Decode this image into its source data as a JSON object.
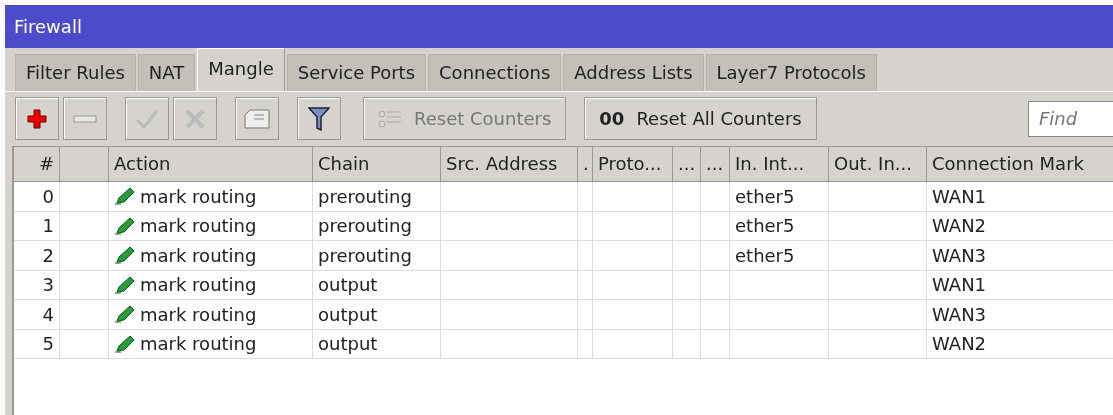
{
  "window": {
    "title": "Firewall"
  },
  "tabs": [
    {
      "label": "Filter Rules",
      "selected": false
    },
    {
      "label": "NAT",
      "selected": false
    },
    {
      "label": "Mangle",
      "selected": true
    },
    {
      "label": "Service Ports",
      "selected": false
    },
    {
      "label": "Connections",
      "selected": false
    },
    {
      "label": "Address Lists",
      "selected": false
    },
    {
      "label": "Layer7 Protocols",
      "selected": false
    }
  ],
  "toolbar": [
    {
      "kind": "add",
      "disabled": false
    },
    {
      "kind": "remove",
      "disabled": false
    },
    {
      "kind": "enable",
      "disabled": true
    },
    {
      "kind": "disable",
      "disabled": true
    },
    {
      "kind": "comment",
      "disabled": false
    },
    {
      "kind": "filter",
      "disabled": false
    },
    {
      "kind": "reset",
      "label": "Reset Counters",
      "disabled": true
    },
    {
      "kind": "reset_all",
      "mark": "00",
      "label": "Reset All Counters",
      "disabled": false
    }
  ],
  "search": {
    "placeholder": "Find"
  },
  "table": {
    "columns": [
      "#",
      "",
      "Action",
      "Chain",
      "Src. Address",
      ".",
      "Proto...",
      "...",
      "...",
      "In. Int...",
      "Out. In...",
      "Connection Mark"
    ],
    "rows": [
      {
        "number": "0",
        "action": "mark routing",
        "chain": "prerouting",
        "in_interface": "ether5",
        "connection_mark": "WAN1"
      },
      {
        "number": "1",
        "action": "mark routing",
        "chain": "prerouting",
        "in_interface": "ether5",
        "connection_mark": "WAN2"
      },
      {
        "number": "2",
        "action": "mark routing",
        "chain": "prerouting",
        "in_interface": "ether5",
        "connection_mark": "WAN3"
      },
      {
        "number": "3",
        "action": "mark routing",
        "chain": "output",
        "connection_mark": "WAN1"
      },
      {
        "number": "4",
        "action": "mark routing",
        "chain": "output",
        "connection_mark": "WAN3"
      },
      {
        "number": "5",
        "action": "mark routing",
        "chain": "output",
        "connection_mark": "WAN2"
      }
    ]
  }
}
